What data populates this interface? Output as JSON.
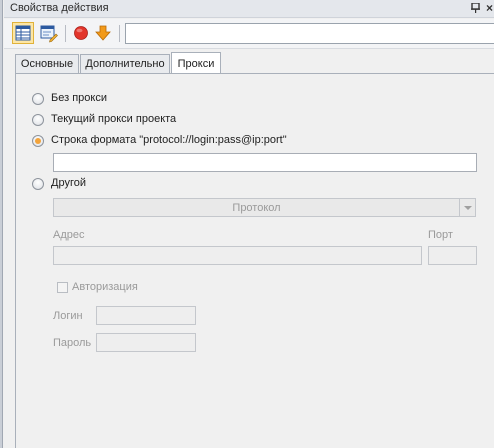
{
  "window": {
    "title": "Свойства действия"
  },
  "toolbar": {
    "buttons": [
      {
        "name": "table-view-icon"
      },
      {
        "name": "edit-properties-icon"
      },
      {
        "name": "stop-icon",
        "color": "#e2352b"
      },
      {
        "name": "arrow-down-icon",
        "color": "#f29a1a"
      }
    ],
    "input_value": ""
  },
  "tabs": [
    {
      "label": "Основные",
      "selected": false
    },
    {
      "label": "Дополнительно",
      "selected": false
    },
    {
      "label": "Прокси",
      "selected": true
    }
  ],
  "proxy": {
    "options": [
      {
        "label": "Без прокси",
        "checked": false
      },
      {
        "label": "Текущий прокси проекта",
        "checked": false
      },
      {
        "label": "Строка формата \"protocol://login:pass@ip:port\"",
        "checked": true
      },
      {
        "label": "Другой",
        "checked": false
      }
    ],
    "format_string_value": "",
    "protocol_combo": "Протокол",
    "address_label": "Адрес",
    "address_value": "",
    "port_label": "Порт",
    "port_value": "",
    "auth_label": "Авторизация",
    "auth_checked": false,
    "login_label": "Логин",
    "login_value": "",
    "password_label": "Пароль",
    "password_value": ""
  },
  "colors": {
    "accent_radio": "#f2a33a",
    "active_button_bg": "#fde6a5"
  }
}
